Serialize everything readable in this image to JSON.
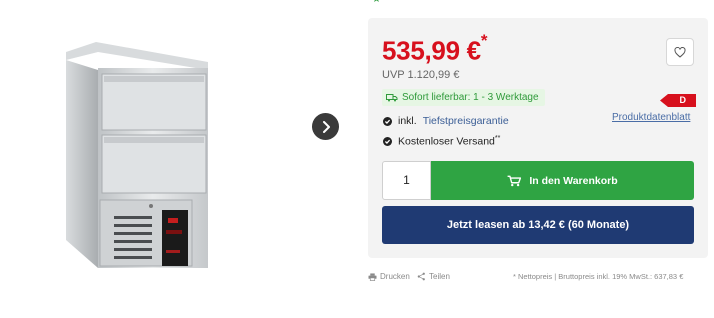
{
  "product": {
    "price": "535,99 €",
    "price_asterisk": "*",
    "uvp": "UVP 1.120,99 €",
    "stock_text": "Sofort lieferbar: 1 - 3 Werktage",
    "energy_class": "D",
    "datasheet_link": "Produktdatenblatt",
    "features": [
      {
        "prefix": "inkl.",
        "link": "Tiefstpreisgarantie"
      },
      {
        "text": "Kostenloser Versand",
        "suffix": "**"
      }
    ],
    "quantity": "1",
    "cart_button": "In den Warenkorb",
    "lease_button": "Jetzt leasen ab 13,42 € (60 Monate)"
  },
  "footer": {
    "print": "Drucken",
    "share": "Teilen",
    "tax_note": "* Nettopreis | Bruttopreis inkl. 19% MwSt.: 637,83 €"
  },
  "colors": {
    "price_red": "#d7101d",
    "cart_green": "#2fa443",
    "lease_navy": "#1f3a73",
    "stock_green": "#2f9a3a",
    "energy_red": "#d7101d"
  },
  "icons": [
    "chevron-right-icon",
    "heart-icon",
    "truck-icon",
    "check-icon",
    "cart-icon",
    "printer-icon",
    "share-icon"
  ]
}
